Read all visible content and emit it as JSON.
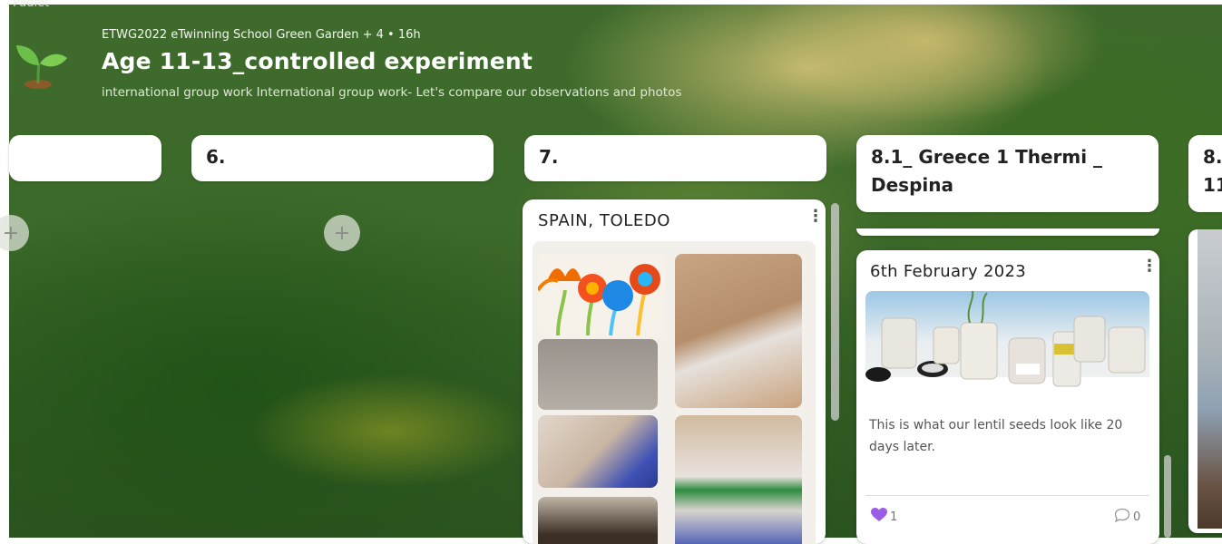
{
  "app": {
    "brand": "Padlet"
  },
  "board": {
    "breadcrumb": "ETWG2022 eTwinning School Green Garden  + 4  • 16h",
    "title": "Age 11-13_controlled experiment",
    "subtitle": "international group work International group work- Let's compare our observations and photos"
  },
  "columns": [
    {
      "header": ""
    },
    {
      "header": "6."
    },
    {
      "header": "7."
    },
    {
      "header": "8.1_ Greece 1 Thermi _ Despina"
    },
    {
      "header": "8.",
      "header_line2": "11"
    }
  ],
  "add_label": "+",
  "posts": {
    "spain": {
      "title": "SPAIN, TOLEDO",
      "menu": "⋮"
    },
    "greece": {
      "title": "6th February 2023",
      "menu": "⋮",
      "body": "This is what our lentil seeds look like 20 days later.",
      "likes": "1",
      "comments": "0"
    }
  },
  "colors": {
    "accent_heart": "#9b5de5",
    "card": "#ffffff",
    "background": "#3c6a2a"
  }
}
